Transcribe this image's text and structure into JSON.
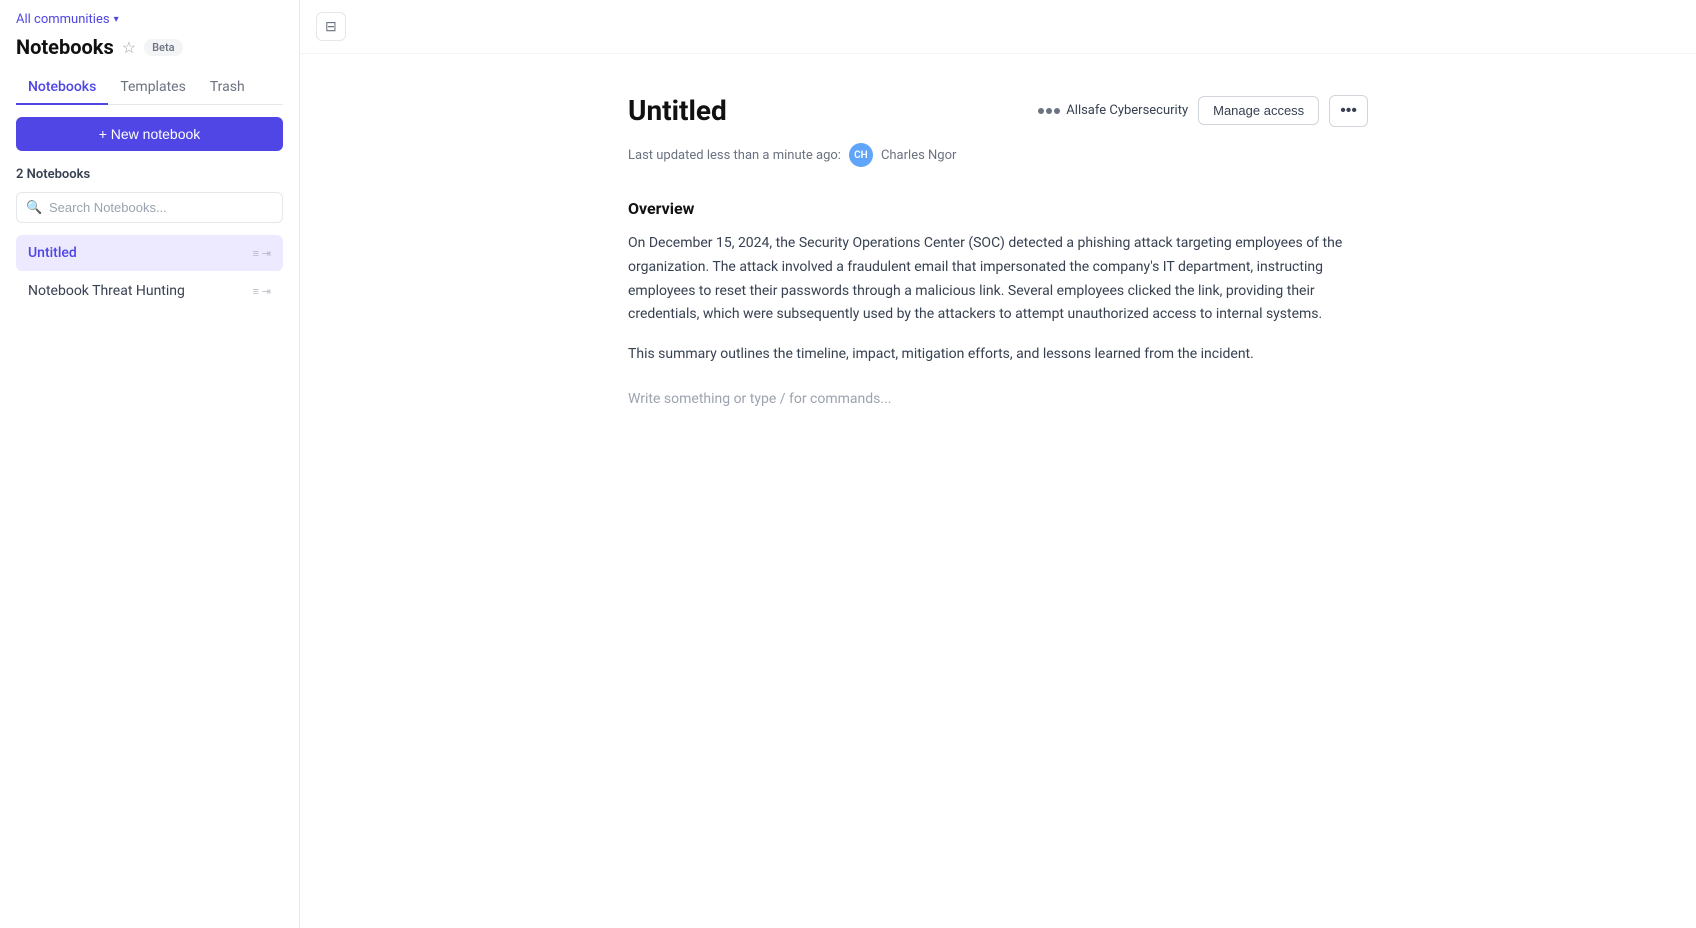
{
  "sidebar": {
    "community_label": "All communities",
    "title": "Notebooks",
    "beta_label": "Beta",
    "tabs": [
      {
        "id": "notebooks",
        "label": "Notebooks",
        "active": true
      },
      {
        "id": "templates",
        "label": "Templates",
        "active": false
      },
      {
        "id": "trash",
        "label": "Trash",
        "active": false
      }
    ],
    "new_notebook_button": "+ New notebook",
    "notebooks_count_label": "2 Notebooks",
    "search_placeholder": "Search Notebooks...",
    "notebooks": [
      {
        "id": "untitled",
        "label": "Untitled",
        "active": true,
        "actions": "≡ ≺/≻"
      },
      {
        "id": "threat-hunting",
        "label": "Notebook Threat Hunting",
        "active": false,
        "actions": "≡ ≺/≻"
      }
    ]
  },
  "toolbar": {
    "toggle_sidebar_icon": "sidebar-icon"
  },
  "main": {
    "notebook_title": "Untitled",
    "community_name": "Allsafe Cybersecurity",
    "manage_access_label": "Manage access",
    "more_icon": "•••",
    "last_updated_text": "Last updated less than a minute ago:",
    "author_initials": "CH",
    "author_name": "Charles Ngor",
    "overview_heading": "Overview",
    "paragraph1": "On December 15, 2024, the Security Operations Center (SOC) detected a phishing attack targeting employees of the organization. The attack involved a fraudulent email that impersonated the company's IT department, instructing employees to reset their passwords through a malicious link. Several employees clicked the link, providing their credentials, which were subsequently used by the attackers to attempt unauthorized access to internal systems.",
    "paragraph2": "This summary outlines the timeline, impact, mitigation efforts, and lessons learned from the incident.",
    "write_placeholder": "Write something or type / for commands..."
  }
}
